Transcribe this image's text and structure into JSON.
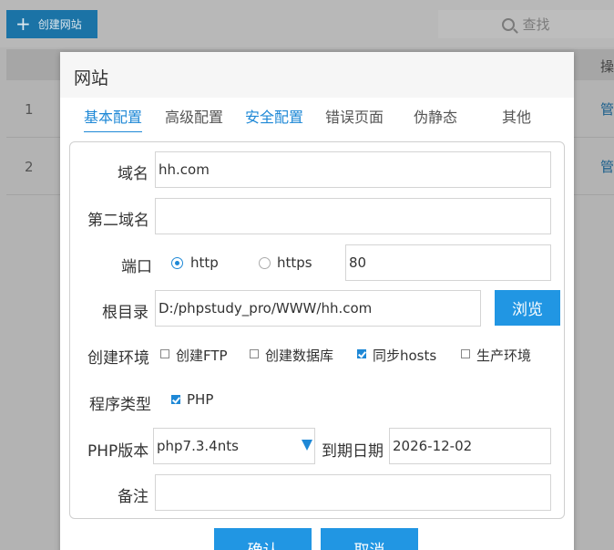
{
  "background": {
    "create_button": "创建网站",
    "search_label": "查找",
    "column_ops": "操",
    "rows": [
      {
        "index": "1",
        "action": "管"
      },
      {
        "index": "2",
        "action": "管"
      }
    ]
  },
  "modal": {
    "title": "网站",
    "tabs": [
      "基本配置",
      "高级配置",
      "安全配置",
      "错误页面",
      "伪静态",
      "其他"
    ],
    "active_tab": "基本配置",
    "form": {
      "domain_label": "域名",
      "domain_value": "hh.com",
      "second_domain_label": "第二域名",
      "second_domain_value": "",
      "port_label": "端口",
      "protocol_http": "http",
      "protocol_https": "https",
      "protocol_selected": "http",
      "port_value": "80",
      "root_label": "根目录",
      "root_value": "D:/phpstudy_pro/WWW/hh.com",
      "browse_button": "浏览",
      "env_label": "创建环境",
      "env_options": [
        {
          "label": "创建FTP",
          "checked": false
        },
        {
          "label": "创建数据库",
          "checked": false
        },
        {
          "label": "同步hosts",
          "checked": true
        },
        {
          "label": "生产环境",
          "checked": false
        }
      ],
      "program_type_label": "程序类型",
      "program_type_option": "PHP",
      "php_version_label": "PHP版本",
      "php_version_value": "php7.3.4nts",
      "expiry_label": "到期日期",
      "expiry_value": "2026-12-02",
      "note_label": "备注",
      "note_value": ""
    },
    "confirm_button": "确认",
    "cancel_button": "取消"
  },
  "colors": {
    "accent": "#2196e3",
    "overlay": "#b3b3b3"
  }
}
